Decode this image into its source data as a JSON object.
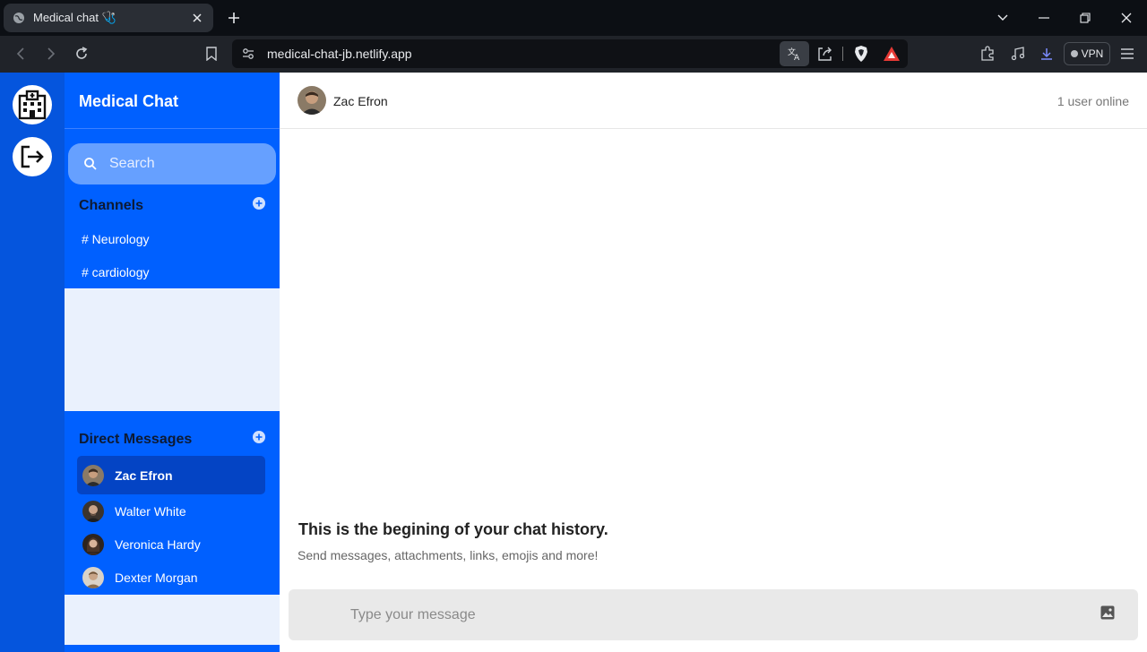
{
  "browser": {
    "tab_title": "Medical chat 🩺",
    "url": "medical-chat-jb.netlify.app",
    "vpn_label": "VPN"
  },
  "rail": {
    "icons": [
      "hospital-icon",
      "logout-icon"
    ]
  },
  "sidebar": {
    "title": "Medical Chat",
    "search_placeholder": "Search",
    "channels_title": "Channels",
    "channels": [
      {
        "label": "# Neurology"
      },
      {
        "label": "# cardiology"
      }
    ],
    "dm_title": "Direct Messages",
    "dms": [
      {
        "name": "Zac Efron",
        "active": true
      },
      {
        "name": "Walter White",
        "active": false
      },
      {
        "name": "Veronica Hardy",
        "active": false
      },
      {
        "name": "Dexter Morgan",
        "active": false
      }
    ]
  },
  "chat": {
    "user_name": "Zac Efron",
    "online_status": "1 user online",
    "intro_title": "This is the begining of your chat history.",
    "intro_subtitle": "Send messages, attachments, links, emojis and more!",
    "composer_placeholder": "Type your message"
  },
  "colors": {
    "rail": "#0555dd",
    "sidebar_accent": "#0060ff",
    "active_item": "#0444c4",
    "sidebar_light": "#eaf1fd"
  }
}
